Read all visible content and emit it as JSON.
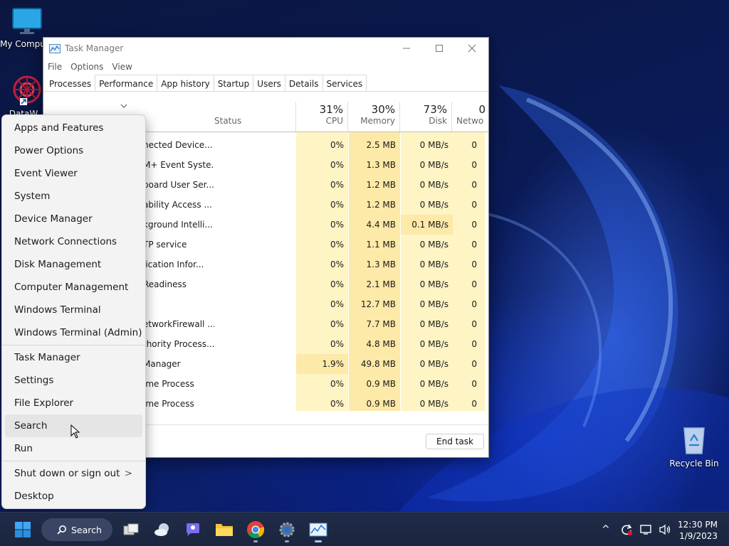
{
  "desktop": {
    "icons": [
      {
        "label": "My Computer"
      },
      {
        "label": "DataW..."
      },
      {
        "label": "Recycle Bin"
      }
    ]
  },
  "task_manager": {
    "title": "Task Manager",
    "menu": [
      "File",
      "Options",
      "View"
    ],
    "tabs": [
      "Processes",
      "Performance",
      "App history",
      "Startup",
      "Users",
      "Details",
      "Services"
    ],
    "active_tab": "Processes",
    "columns": {
      "status": "Status",
      "cpu": {
        "pct": "31%",
        "name": "CPU"
      },
      "memory": {
        "pct": "30%",
        "name": "Memory"
      },
      "disk": {
        "pct": "73%",
        "name": "Disk"
      },
      "network": {
        "pct": "0",
        "name": "Netwo"
      }
    },
    "rows": [
      {
        "name": "nected Device...",
        "cpu": "0%",
        "mem": "2.5 MB",
        "disk": "0 MB/s",
        "net": "0"
      },
      {
        "name": "M+ Event Syste...",
        "cpu": "0%",
        "mem": "1.3 MB",
        "disk": "0 MB/s",
        "net": "0"
      },
      {
        "name": "board User Ser...",
        "cpu": "0%",
        "mem": "1.2 MB",
        "disk": "0 MB/s",
        "net": "0"
      },
      {
        "name": "ability Access ...",
        "cpu": "0%",
        "mem": "1.2 MB",
        "disk": "0 MB/s",
        "net": "0"
      },
      {
        "name": "kground Intelli...",
        "cpu": "0%",
        "mem": "4.4 MB",
        "disk": "0.1 MB/s",
        "net": "0",
        "disk_highlight": true
      },
      {
        "name": "TP service",
        "cpu": "0%",
        "mem": "1.1 MB",
        "disk": "0 MB/s",
        "net": "0"
      },
      {
        "name": "lication Infor...",
        "cpu": "0%",
        "mem": "1.3 MB",
        "disk": "0 MB/s",
        "net": "0"
      },
      {
        "name": " Readiness",
        "cpu": "0%",
        "mem": "2.1 MB",
        "disk": "0 MB/s",
        "net": "0"
      },
      {
        "name": "",
        "cpu": "0%",
        "mem": "12.7 MB",
        "disk": "0 MB/s",
        "net": "0"
      },
      {
        "name": "etworkFirewall ...",
        "cpu": "0%",
        "mem": "7.7 MB",
        "disk": "0 MB/s",
        "net": "0"
      },
      {
        "name": "thority Process...",
        "cpu": "0%",
        "mem": "4.8 MB",
        "disk": "0 MB/s",
        "net": "0"
      },
      {
        "name": "Manager",
        "cpu": "1.9%",
        "mem": "49.8 MB",
        "disk": "0 MB/s",
        "net": "0",
        "cpu_highlight": true
      },
      {
        "name": "ime Process",
        "cpu": "0%",
        "mem": "0.9 MB",
        "disk": "0 MB/s",
        "net": "0"
      },
      {
        "name": "ime Process",
        "cpu": "0%",
        "mem": "0.9 MB",
        "disk": "0 MB/s",
        "net": "0"
      }
    ],
    "end_task_label": "End task"
  },
  "winx_menu": {
    "groups": [
      [
        "Apps and Features",
        "Power Options",
        "Event Viewer",
        "System",
        "Device Manager",
        "Network Connections",
        "Disk Management",
        "Computer Management",
        "Windows Terminal",
        "Windows Terminal (Admin)"
      ],
      [
        "Task Manager",
        "Settings",
        "File Explorer",
        "Search",
        "Run"
      ],
      [
        "Shut down or sign out",
        "Desktop"
      ]
    ],
    "hovered": "Search",
    "submenu_arrow": ">"
  },
  "taskbar": {
    "search_label": "Search",
    "clock_time": "12:30 PM",
    "clock_date": "1/9/2023",
    "tray_chevron": "^"
  },
  "colors": {
    "accent": "#0a66d8",
    "heat_light": "#fff4c4",
    "heat_medium": "#fde9a8"
  }
}
